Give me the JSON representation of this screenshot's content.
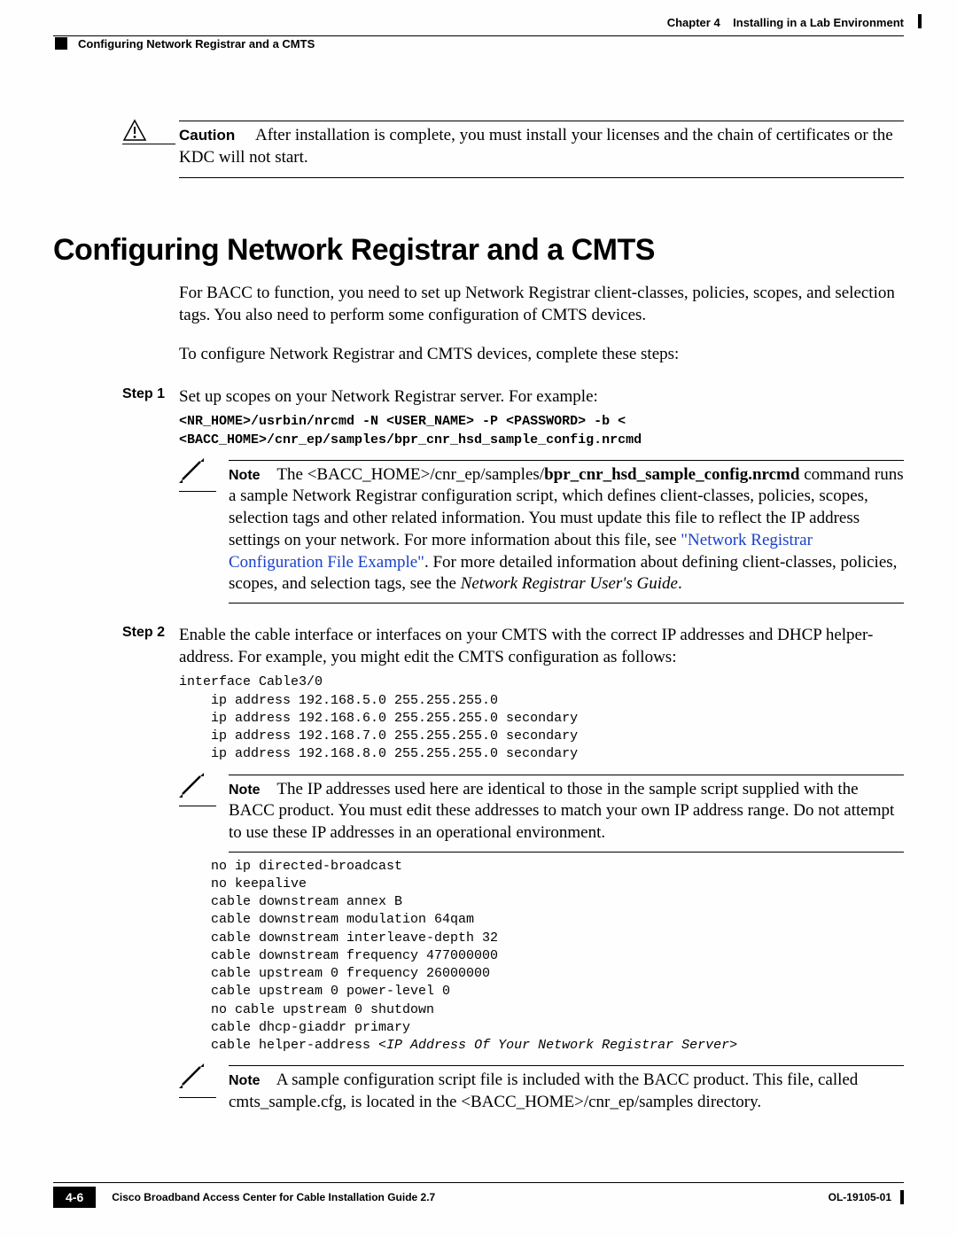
{
  "header": {
    "chapter_label": "Chapter 4",
    "chapter_title": "Installing in a Lab Environment",
    "topic": "Configuring Network Registrar and a CMTS"
  },
  "caution": {
    "label": "Caution",
    "text": "After installation is complete, you must install your licenses and the chain of certificates or the KDC will not start."
  },
  "section": {
    "title": "Configuring Network Registrar and a CMTS",
    "intro1": "For BACC to function, you need to set up Network Registrar client-classes, policies, scopes, and selection tags. You also need to perform some configuration of CMTS devices.",
    "intro2": "To configure Network Registrar and CMTS devices, complete these steps:"
  },
  "step1": {
    "label": "Step 1",
    "text": "Set up scopes on your Network Registrar server. For example:",
    "cmd": "<NR_HOME>/usrbin/nrcmd -N <USER_NAME> -P <PASSWORD> -b <\n<BACC_HOME>/cnr_ep/samples/bpr_cnr_hsd_sample_config.nrcmd",
    "note_label": "Note",
    "note_pre": "The <BACC_HOME>/cnr_ep/samples/",
    "note_bold": "bpr_cnr_hsd_sample_config.nrcmd",
    "note_mid": " command runs a sample Network Registrar configuration script, which defines client-classes, policies, scopes, selection tags and other related information. You must update this file to reflect the IP address settings on your network. For more information about this file, see ",
    "note_link": "\"Network Registrar Configuration File Example\"",
    "note_post1": ". For more detailed information about defining client-classes, policies, scopes, and selection tags, see the ",
    "note_italic": "Network Registrar User's Guide",
    "note_post2": "."
  },
  "step2": {
    "label": "Step 2",
    "text": "Enable the cable interface or interfaces on your CMTS with the correct IP addresses and DHCP helper-address. For example, you might edit the CMTS configuration as follows:",
    "code1": "interface Cable3/0\n    ip address 192.168.5.0 255.255.255.0\n    ip address 192.168.6.0 255.255.255.0 secondary\n    ip address 192.168.7.0 255.255.255.0 secondary\n    ip address 192.168.8.0 255.255.255.0 secondary",
    "note1_label": "Note",
    "note1_text": "The IP addresses used here are identical to those in the sample script supplied with the BACC product. You must edit these addresses to match your own IP address range. Do not attempt to use these IP addresses in an operational environment.",
    "code2_pre": "    no ip directed-broadcast\n    no keepalive\n    cable downstream annex B\n    cable downstream modulation 64qam\n    cable downstream interleave-depth 32\n    cable downstream frequency 477000000\n    cable upstream 0 frequency 26000000\n    cable upstream 0 power-level 0\n    no cable upstream 0 shutdown\n    cable dhcp-giaddr primary\n    cable helper-address ",
    "code2_italic": "<IP Address Of Your Network Registrar Server>",
    "note2_label": "Note",
    "note2_text": "A sample configuration script file is included with the BACC product. This file, called cmts_sample.cfg, is located in the <BACC_HOME>/cnr_ep/samples directory."
  },
  "footer": {
    "book_title": "Cisco Broadband Access Center for Cable Installation Guide 2.7",
    "page_number": "4-6",
    "doc_id": "OL-19105-01"
  }
}
